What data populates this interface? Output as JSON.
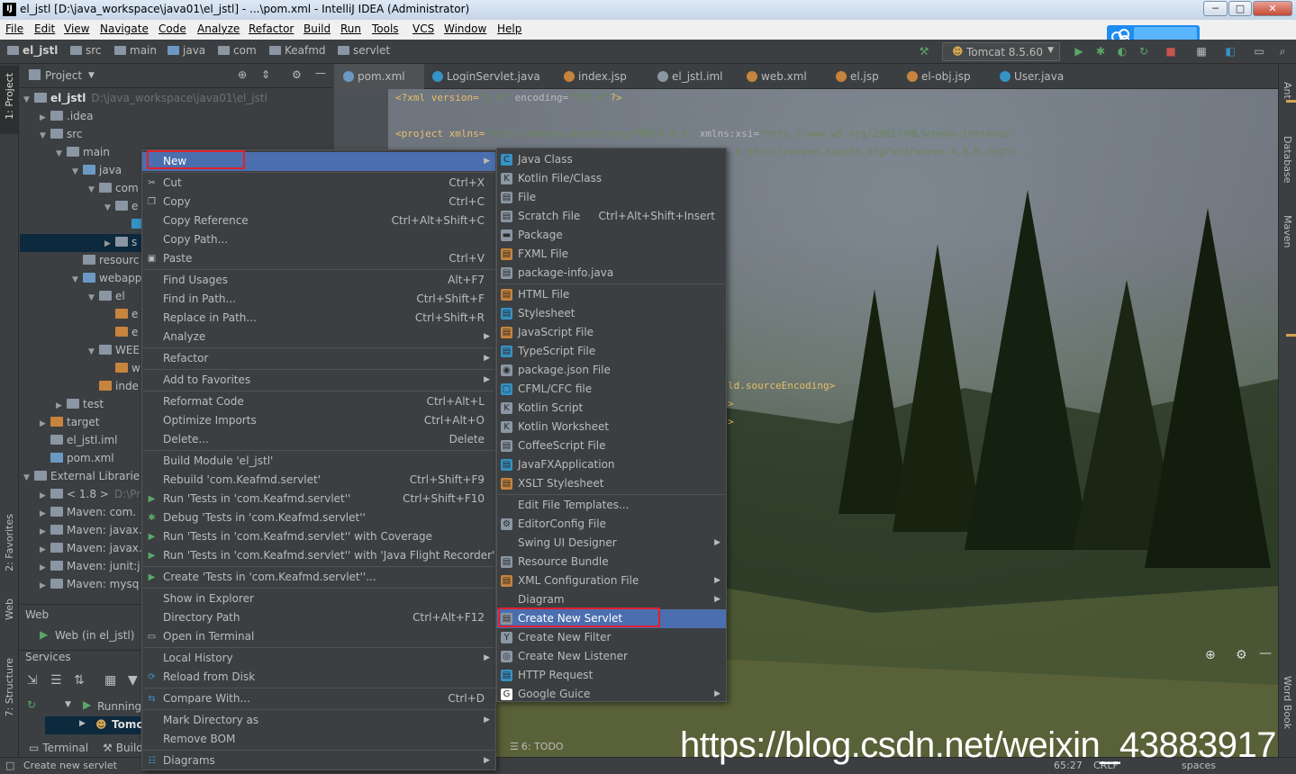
{
  "window": {
    "title": "el_jstl [D:\\java_workspace\\java01\\el_jstl] - ...\\pom.xml - IntelliJ IDEA (Administrator)",
    "app_icon": "IJ",
    "minimize": "─",
    "maximize": "□",
    "close": "✕"
  },
  "menubar": [
    "File",
    "Edit",
    "View",
    "Navigate",
    "Code",
    "Analyze",
    "Refactor",
    "Build",
    "Run",
    "Tools",
    "VCS",
    "Window",
    "Help"
  ],
  "breadcrumbs": [
    "el_jstl",
    "src",
    "main",
    "java",
    "com",
    "Keafmd",
    "servlet"
  ],
  "run_config": "Tomcat 8.5.60",
  "project_panel": {
    "title": "Project",
    "tree": [
      {
        "label": "el_jstl",
        "extra": "D:\\java_workspace\\java01\\el_jstl",
        "indent": 0,
        "arrow": "▼",
        "icon": "folder"
      },
      {
        "label": ".idea",
        "indent": 1,
        "arrow": "▶",
        "icon": "folder"
      },
      {
        "label": "src",
        "indent": 1,
        "arrow": "▼",
        "icon": "folder"
      },
      {
        "label": "main",
        "indent": 2,
        "arrow": "▼",
        "icon": "folder"
      },
      {
        "label": "java",
        "indent": 3,
        "arrow": "▼",
        "icon": "folder-blue"
      },
      {
        "label": "com",
        "indent": 4,
        "arrow": "▼",
        "icon": "folder"
      },
      {
        "label": "e",
        "indent": 5,
        "arrow": "▼",
        "icon": "folder"
      },
      {
        "label": "",
        "indent": 6,
        "arrow": "",
        "icon": "class"
      },
      {
        "label": "s",
        "indent": 5,
        "arrow": "▶",
        "icon": "folder"
      },
      {
        "label": "resourc",
        "indent": 3,
        "arrow": "",
        "icon": "folder"
      },
      {
        "label": "webapp",
        "indent": 3,
        "arrow": "▼",
        "icon": "folder-blue"
      },
      {
        "label": "el",
        "indent": 4,
        "arrow": "▼",
        "icon": "folder"
      },
      {
        "label": "e",
        "indent": 5,
        "arrow": "",
        "icon": "jsp"
      },
      {
        "label": "e",
        "indent": 5,
        "arrow": "",
        "icon": "jsp"
      },
      {
        "label": "WEE",
        "indent": 4,
        "arrow": "▼",
        "icon": "folder"
      },
      {
        "label": "w",
        "indent": 5,
        "arrow": "",
        "icon": "xml"
      },
      {
        "label": "inde",
        "indent": 4,
        "arrow": "",
        "icon": "jsp"
      },
      {
        "label": "test",
        "indent": 2,
        "arrow": "▶",
        "icon": "folder"
      },
      {
        "label": "target",
        "indent": 1,
        "arrow": "▶",
        "icon": "folder-orange"
      },
      {
        "label": "el_jstl.iml",
        "indent": 1,
        "arrow": "",
        "icon": "iml"
      },
      {
        "label": "pom.xml",
        "indent": 1,
        "arrow": "",
        "icon": "maven"
      },
      {
        "label": "External Librarie",
        "indent": 0,
        "arrow": "▼",
        "icon": "lib"
      },
      {
        "label": "< 1.8 >",
        "extra": "D:\\Pr",
        "indent": 1,
        "arrow": "▶",
        "icon": "lib"
      },
      {
        "label": "Maven: com.",
        "indent": 1,
        "arrow": "▶",
        "icon": "lib"
      },
      {
        "label": "Maven: javax.",
        "indent": 1,
        "arrow": "▶",
        "icon": "lib"
      },
      {
        "label": "Maven: javax.",
        "indent": 1,
        "arrow": "▶",
        "icon": "lib"
      },
      {
        "label": "Maven: junit:j",
        "indent": 1,
        "arrow": "▶",
        "icon": "lib"
      },
      {
        "label": "Maven: mysq",
        "indent": 1,
        "arrow": "▶",
        "icon": "lib"
      }
    ]
  },
  "web_panel": {
    "title": "Web",
    "item": "Web (in el_jstl)"
  },
  "services_panel": {
    "title": "Services",
    "running": "Running",
    "tomcat": "Tomc"
  },
  "left_strip": {
    "project": "1: Project",
    "favorites": "2: Favorites",
    "web": "Web",
    "structure": "7: Structure"
  },
  "right_strip": {
    "ant": "Ant",
    "database": "Database",
    "maven": "Maven",
    "wordbook": "Word Book"
  },
  "editor_tabs": [
    {
      "label": "pom.xml",
      "icon": "maven",
      "color": "#6c99c4",
      "active": true
    },
    {
      "label": "LoginServlet.java",
      "icon": "class",
      "color": "#3592c4"
    },
    {
      "label": "index.jsp",
      "icon": "jsp",
      "color": "#c7843e"
    },
    {
      "label": "el_jstl.iml",
      "icon": "iml",
      "color": "#8a96a3"
    },
    {
      "label": "web.xml",
      "icon": "xml",
      "color": "#c7843e"
    },
    {
      "label": "el.jsp",
      "icon": "jsp",
      "color": "#c7843e"
    },
    {
      "label": "el-obj.jsp",
      "icon": "jsp",
      "color": "#c7843e"
    },
    {
      "label": "User.java",
      "icon": "class",
      "color": "#3592c4"
    }
  ],
  "code": {
    "line1": {
      "open": "<?xml version=",
      "v1": "\"1.0\"",
      "mid": " encoding=",
      "v2": "\"UTF-8\"",
      "close": "?>"
    },
    "line2": {
      "tag": "<project xmlns=",
      "url": "\"http://maven.apache.org/POM/4.0.0\"",
      "attr": " xmlns:xsi=",
      "url2": "\"http://www.w3.org/2001/XMLSchema-instance\""
    },
    "line3": ".0 http://maven.apache.org/xsd/maven-4.0.0.xsd\">",
    "line_enc": "ld.sourceEncoding>",
    "line_gt1": ">",
    "line_gt2": ">"
  },
  "context_menu": [
    {
      "label": "New",
      "shortcut": "",
      "submenu": true,
      "selected": true
    },
    {
      "sep": true
    },
    {
      "label": "Cut",
      "shortcut": "Ctrl+X",
      "icon": "cut-icon",
      "glyph": "✂"
    },
    {
      "label": "Copy",
      "shortcut": "Ctrl+C",
      "icon": "copy-icon",
      "glyph": "❐"
    },
    {
      "label": "Copy Reference",
      "shortcut": "Ctrl+Alt+Shift+C"
    },
    {
      "label": "Copy Path...",
      "shortcut": ""
    },
    {
      "label": "Paste",
      "shortcut": "Ctrl+V",
      "icon": "paste-icon",
      "glyph": "▣"
    },
    {
      "sep": true
    },
    {
      "label": "Find Usages",
      "shortcut": "Alt+F7"
    },
    {
      "label": "Find in Path...",
      "shortcut": "Ctrl+Shift+F"
    },
    {
      "label": "Replace in Path...",
      "shortcut": "Ctrl+Shift+R"
    },
    {
      "label": "Analyze",
      "submenu": true
    },
    {
      "sep": true
    },
    {
      "label": "Refactor",
      "submenu": true
    },
    {
      "sep": true
    },
    {
      "label": "Add to Favorites",
      "submenu": true
    },
    {
      "sep": true
    },
    {
      "label": "Reformat Code",
      "shortcut": "Ctrl+Alt+L"
    },
    {
      "label": "Optimize Imports",
      "shortcut": "Ctrl+Alt+O"
    },
    {
      "label": "Delete...",
      "shortcut": "Delete"
    },
    {
      "sep": true
    },
    {
      "label": "Build Module 'el_jstl'"
    },
    {
      "label": "Rebuild 'com.Keafmd.servlet'",
      "shortcut": "Ctrl+Shift+F9"
    },
    {
      "label": "Run 'Tests in 'com.Keafmd.servlet''",
      "shortcut": "Ctrl+Shift+F10",
      "icon": "run-icon",
      "glyph": "▶",
      "gcolor": "#59a869"
    },
    {
      "label": "Debug 'Tests in 'com.Keafmd.servlet''",
      "icon": "debug-icon",
      "glyph": "✱",
      "gcolor": "#59a869"
    },
    {
      "label": "Run 'Tests in 'com.Keafmd.servlet'' with Coverage",
      "icon": "coverage-icon",
      "glyph": "▶",
      "gcolor": "#59a869"
    },
    {
      "label": "Run 'Tests in 'com.Keafmd.servlet'' with 'Java Flight Recorder'",
      "icon": "jfr-icon",
      "glyph": "▶",
      "gcolor": "#59a869"
    },
    {
      "sep": true
    },
    {
      "label": "Create 'Tests in 'com.Keafmd.servlet''...",
      "icon": "create-icon",
      "glyph": "▶",
      "gcolor": "#59a869"
    },
    {
      "sep": true
    },
    {
      "label": "Show in Explorer"
    },
    {
      "label": "Directory Path",
      "shortcut": "Ctrl+Alt+F12"
    },
    {
      "label": "Open in Terminal",
      "icon": "terminal-icon",
      "glyph": "▭"
    },
    {
      "sep": true
    },
    {
      "label": "Local History",
      "submenu": true
    },
    {
      "label": "Reload from Disk",
      "icon": "reload-icon",
      "glyph": "⟳",
      "gcolor": "#3592c4"
    },
    {
      "sep": true
    },
    {
      "label": "Compare With...",
      "shortcut": "Ctrl+D",
      "icon": "compare-icon",
      "glyph": "⇆",
      "gcolor": "#3592c4"
    },
    {
      "sep": true
    },
    {
      "label": "Mark Directory as",
      "submenu": true
    },
    {
      "label": "Remove BOM"
    },
    {
      "sep": true
    },
    {
      "label": "Diagrams",
      "submenu": true,
      "icon": "diagram-icon",
      "glyph": "☷",
      "gcolor": "#3592c4"
    }
  ],
  "new_submenu": [
    {
      "label": "Java Class",
      "icon": "java-class-icon",
      "color": "#3592c4",
      "glyph": "C"
    },
    {
      "label": "Kotlin File/Class",
      "icon": "kotlin-icon",
      "color": "#8a96a3",
      "glyph": "K"
    },
    {
      "label": "File",
      "icon": "file-icon",
      "color": "#8a96a3",
      "glyph": "▤"
    },
    {
      "label": "Scratch File",
      "shortcut": "Ctrl+Alt+Shift+Insert",
      "icon": "scratch-icon",
      "color": "#8a96a3",
      "glyph": "▤"
    },
    {
      "label": "Package",
      "icon": "package-icon",
      "color": "#8a96a3",
      "glyph": "▬"
    },
    {
      "label": "FXML File",
      "icon": "fxml-icon",
      "color": "#c7843e",
      "glyph": "▤"
    },
    {
      "label": "package-info.java",
      "icon": "package-info-icon",
      "color": "#8a96a3",
      "glyph": "▤"
    },
    {
      "sep": true
    },
    {
      "label": "HTML File",
      "icon": "html-icon",
      "color": "#c7843e",
      "glyph": "▤"
    },
    {
      "label": "Stylesheet",
      "icon": "css-icon",
      "color": "#3592c4",
      "glyph": "▤"
    },
    {
      "label": "JavaScript File",
      "icon": "js-icon",
      "color": "#c7843e",
      "glyph": "▤"
    },
    {
      "label": "TypeScript File",
      "icon": "ts-icon",
      "color": "#3592c4",
      "glyph": "▤"
    },
    {
      "label": "package.json File",
      "icon": "npm-icon",
      "color": "#8a96a3",
      "glyph": "◉"
    },
    {
      "label": "CFML/CFC file",
      "icon": "cfml-icon",
      "color": "#3592c4",
      "glyph": "□"
    },
    {
      "label": "Kotlin Script",
      "icon": "kotlin-script-icon",
      "color": "#8a96a3",
      "glyph": "K"
    },
    {
      "label": "Kotlin Worksheet",
      "icon": "kotlin-worksheet-icon",
      "color": "#8a96a3",
      "glyph": "K"
    },
    {
      "label": "CoffeeScript File",
      "icon": "coffee-icon",
      "color": "#8a96a3",
      "glyph": "▤"
    },
    {
      "label": "JavaFXApplication",
      "icon": "javafx-icon",
      "color": "#3592c4",
      "glyph": "▤"
    },
    {
      "label": "XSLT Stylesheet",
      "icon": "xslt-icon",
      "color": "#c7843e",
      "glyph": "▤"
    },
    {
      "sep": true
    },
    {
      "label": "Edit File Templates..."
    },
    {
      "label": "EditorConfig File",
      "icon": "gear-icon",
      "color": "#8a96a3",
      "glyph": "⚙"
    },
    {
      "label": "Swing UI Designer",
      "submenu": true
    },
    {
      "label": "Resource Bundle",
      "icon": "bundle-icon",
      "color": "#8a96a3",
      "glyph": "▤"
    },
    {
      "label": "XML Configuration File",
      "submenu": true,
      "icon": "xml-config-icon",
      "color": "#c7843e",
      "glyph": "▤"
    },
    {
      "label": "Diagram",
      "submenu": true
    },
    {
      "label": "Create New Servlet",
      "selected": true,
      "icon": "servlet-icon",
      "color": "#8a96a3",
      "glyph": "▤"
    },
    {
      "label": "Create New Filter",
      "icon": "filter-icon",
      "color": "#8a96a3",
      "glyph": "Y"
    },
    {
      "label": "Create New Listener",
      "icon": "listener-icon",
      "color": "#8a96a3",
      "glyph": "◎"
    },
    {
      "label": "HTTP Request",
      "icon": "http-icon",
      "color": "#3592c4",
      "glyph": "▤"
    },
    {
      "label": "Google Guice",
      "submenu": true,
      "icon": "guice-icon",
      "color": "#ffffff",
      "glyph": "G"
    }
  ],
  "statusbar": {
    "message": "Create new servlet",
    "position": "65:27",
    "crlf": "CRLF",
    "indent": "spaces"
  },
  "bottom_tabs": {
    "terminal": "Terminal",
    "build": "Build",
    "todo": "6: TODO"
  },
  "watermark": "https://blog.csdn.net/weixin_43883917"
}
